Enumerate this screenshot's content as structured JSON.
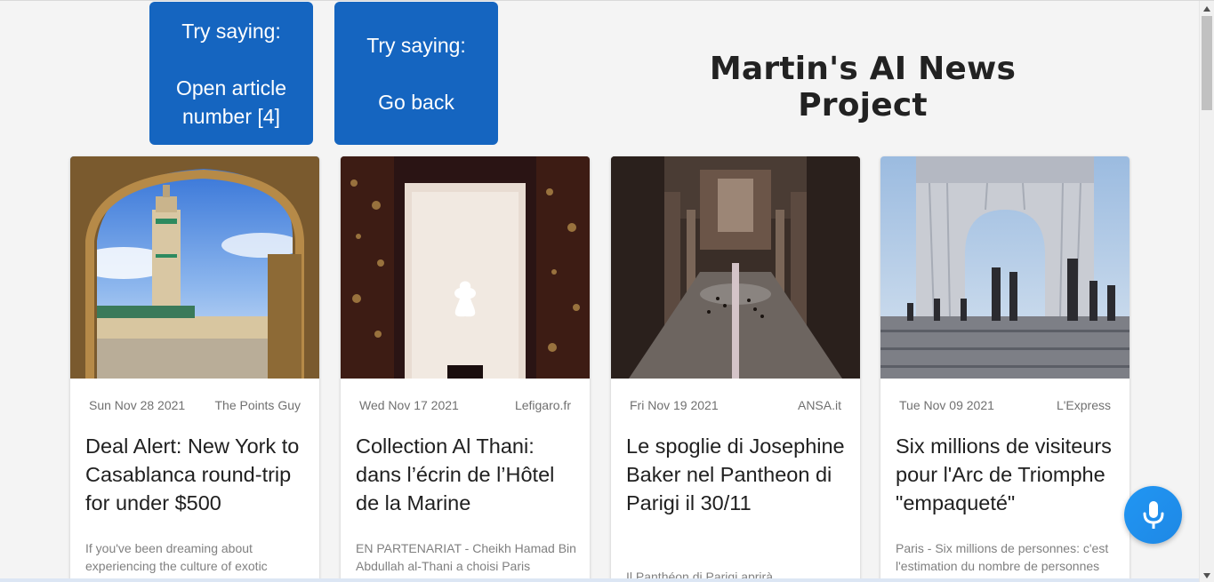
{
  "hints": [
    {
      "label": "Try saying:",
      "command": "Open article number [4]"
    },
    {
      "label": "Try saying:",
      "command": "Go back"
    }
  ],
  "page": {
    "title": "Martin's AI News Project"
  },
  "articles": [
    {
      "date": "Sun Nov 28 2021",
      "source": "The Points Guy",
      "title": "Deal Alert: New York to Casablanca round-trip for under $500",
      "description": "If you've been dreaming about experiencing the culture of exotic",
      "image": "casablanca-mosque-photo"
    },
    {
      "date": "Wed Nov 17 2021",
      "source": "Lefigaro.fr",
      "title": "Collection Al Thani: dans l’écrin de l’Hôtel de la Marine",
      "description": "EN PARTENARIAT - Cheikh Hamad Bin Abdullah al-Thani a choisi Paris",
      "image": "museum-sculpture-photo"
    },
    {
      "date": "Fri Nov 19 2021",
      "source": "ANSA.it",
      "title": "Le spoglie di Josephine Baker nel Pantheon di Parigi il 30/11",
      "description": "Il Panthéon di Parigi aprirà",
      "image": "pantheon-interior-photo"
    },
    {
      "date": "Tue Nov 09 2021",
      "source": "L'Express",
      "title": "Six millions de visiteurs pour l'Arc de Triomphe \"empaqueté\"",
      "description": "Paris - Six millions de personnes: c'est l'estimation du nombre de personnes",
      "image": "arc-de-triomphe-wrapped-photo"
    }
  ],
  "mic_button": {
    "icon": "microphone-icon"
  },
  "colors": {
    "hint_bg": "#1565c0",
    "mic_bg": "#2196f3",
    "page_bg": "#f4f4f4"
  }
}
